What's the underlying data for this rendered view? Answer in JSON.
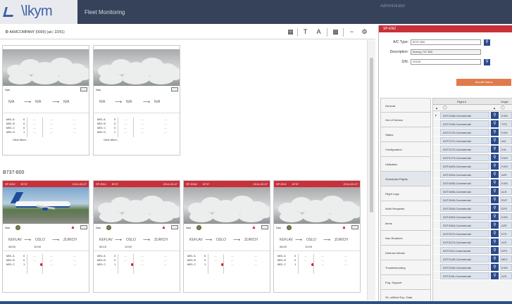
{
  "header": {
    "logo": "\\lkym",
    "title": "Fleet Monitoring",
    "user": "Administrator"
  },
  "toolbar": {
    "label": "AKMCOMPANY (0000) (a/c: 22/51)",
    "icons": [
      "grid-icon",
      "text-icon",
      "font-icon",
      "table-icon",
      "minus-icon",
      "settings-icon"
    ]
  },
  "group": {
    "label": "B737-800"
  },
  "colors": {
    "header": "#35425a",
    "accent_red": "#c8303a",
    "blue": "#2b4a8c",
    "orange": "#e07a4a"
  },
  "top_cards": [
    {
      "status": "Nas",
      "route": {
        "from": "N/A",
        "to": "N/A",
        "mid": "N/A"
      },
      "mel": [
        {
          "label": "MEL A",
          "value": "0"
        },
        {
          "label": "MEL B",
          "value": "0"
        },
        {
          "label": "MEL C",
          "value": "0"
        },
        {
          "label": "MEL D",
          "value": "1"
        }
      ],
      "view_more": "View More..."
    },
    {
      "status": "Nas",
      "route": {
        "from": "N/A",
        "to": "N/A",
        "mid": "N/A"
      },
      "mel": [
        {
          "label": "MEL A",
          "value": "0"
        },
        {
          "label": "MEL B",
          "value": "0"
        },
        {
          "label": "MEL C",
          "value": "0"
        },
        {
          "label": "MEL D",
          "value": "1"
        }
      ],
      "view_more": "View More..."
    }
  ],
  "bottom_cards": [
    {
      "reg": "SP-ENZ",
      "code": "B737",
      "extra": "2014-03-07",
      "status": "Nas",
      "photo": "aircraft",
      "route": {
        "from": "KEFLAV",
        "to": "ZURICH",
        "via": "OSLO"
      },
      "times": [
        "08:00",
        "10:00"
      ],
      "mel": [
        {
          "label": "MEL A",
          "value": "0"
        },
        {
          "label": "MEL B",
          "value": "0"
        },
        {
          "label": "MEL C",
          "value": "1"
        }
      ]
    },
    {
      "reg": "SP-ENX",
      "code": "B737",
      "extra": "2014-03-07",
      "status": "Nas",
      "photo": "clouds",
      "route": {
        "from": "KEFLAV",
        "to": "ZURICH",
        "via": "OSLO"
      },
      "times": [
        "06:15",
        "10:00"
      ],
      "mel": [
        {
          "label": "MEL A",
          "value": "0"
        },
        {
          "label": "MEL B",
          "value": "0"
        },
        {
          "label": "MEL C",
          "value": "1"
        }
      ]
    },
    {
      "reg": "SP-ENW",
      "code": "B737",
      "extra": "2014-03-07",
      "status": "Nas",
      "photo": "clouds",
      "route": {
        "from": "KEFLAV",
        "to": "ZURICH",
        "via": "OSLO"
      },
      "times": [
        "",
        ""
      ],
      "mel": [
        {
          "label": "MEL A",
          "value": "6"
        },
        {
          "label": "MEL B",
          "value": "0"
        },
        {
          "label": "MEL C",
          "value": "1"
        }
      ]
    },
    {
      "reg": "SP-ENV",
      "code": "B737",
      "extra": "2014-03-07",
      "status": "Nas",
      "photo": "clouds",
      "route": {
        "from": "KEFLAV",
        "to": "ZURICH",
        "via": "OSLO"
      },
      "times": [
        "08:00",
        "10:00"
      ],
      "mel": [
        {
          "label": "MEL A",
          "value": "0"
        },
        {
          "label": "MEL B",
          "value": "0"
        },
        {
          "label": "MEL C",
          "value": "1"
        }
      ]
    }
  ],
  "right_panel": {
    "header": "SP-ENZ",
    "fields": [
      {
        "label": "A/C Type:",
        "value": "B737-800"
      },
      {
        "label": "Description:",
        "value": "Boeing 737-800"
      },
      {
        "label": "S/N:",
        "value": "29125"
      }
    ],
    "action_button": "Aircraft Status",
    "nav": [
      "General",
      "Out of Service",
      "Status",
      "Configuration",
      "Utilisation",
      "Scheduled Flights",
      "Flight Logs",
      "Work Requests",
      "Items",
      "Non-Routines",
      "Deferred Works",
      "Troubleshooting",
      "Eng. Support",
      "Sh. oil/fluid Exp. Data"
    ],
    "grid": {
      "headers": [
        "Flight #",
        "Origin"
      ],
      "rows": [
        {
          "flight": "DXT2168-Commercial",
          "origin": "KXM"
        },
        {
          "flight": "DXT2169-Commercial",
          "origin": "TPS"
        },
        {
          "flight": "DXT2170-Commercial",
          "origin": "KXM"
        },
        {
          "flight": "DXT2171-Commercial",
          "origin": "AKI"
        },
        {
          "flight": "DXT2172-Commercial",
          "origin": "KXL"
        },
        {
          "flight": "DXT2173-Commercial",
          "origin": "KXM"
        },
        {
          "flight": "DXT4453-Commercial",
          "origin": "KXM"
        },
        {
          "flight": "DXT4454-Commercial",
          "origin": "AZE"
        },
        {
          "flight": "DXT4455-Commercial",
          "origin": "KXM"
        },
        {
          "flight": "DXT4456-Commercial",
          "origin": "ALE"
        },
        {
          "flight": "DXT2049-Commercial",
          "origin": "RVP"
        },
        {
          "flight": "DXT2050-Commercial",
          "origin": "EPS"
        },
        {
          "flight": "DXT4463-Commercial",
          "origin": "KXM"
        },
        {
          "flight": "DXT4464-Commercial",
          "origin": "AZE"
        },
        {
          "flight": "DXT2072-Commercial",
          "origin": "ETE"
        },
        {
          "flight": "DXT2073-Commercial",
          "origin": "AYE"
        },
        {
          "flight": "DXT2112-Commercial",
          "origin": "EPS"
        },
        {
          "flight": "DXT2149-Commercial",
          "origin": "MEX"
        },
        {
          "flight": "DXT2150-Commercial",
          "origin": "KXM"
        },
        {
          "flight": "DXT2151-Commercial",
          "origin": "AYE"
        }
      ]
    }
  }
}
